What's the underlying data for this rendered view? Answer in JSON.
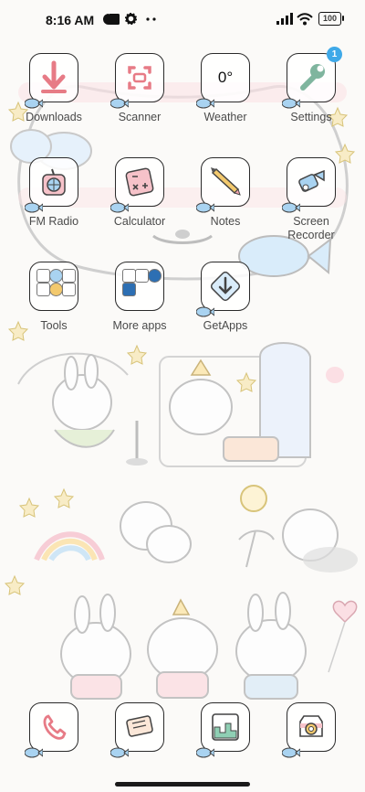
{
  "status_bar": {
    "time": "8:16 AM",
    "battery": "100",
    "icons": [
      "data-saver-icon",
      "square-notification-icon",
      "gear-icon",
      "more-dots-icon",
      "signal-icon",
      "wifi-icon",
      "battery-icon"
    ]
  },
  "apps_row1": [
    {
      "label": "Downloads",
      "icon": "download-arrow-icon"
    },
    {
      "label": "Scanner",
      "icon": "scanner-icon"
    },
    {
      "label": "Weather",
      "icon": "weather-icon",
      "temp": "0°"
    },
    {
      "label": "Settings",
      "icon": "wrench-icon",
      "badge": "1"
    }
  ],
  "apps_row2": [
    {
      "label": "FM Radio",
      "icon": "radio-icon"
    },
    {
      "label": "Calculator",
      "icon": "calculator-icon"
    },
    {
      "label": "Notes",
      "icon": "pencil-icon"
    },
    {
      "label": "Screen Recorder",
      "icon": "camera-recorder-icon"
    }
  ],
  "apps_row3": [
    {
      "label": "Tools",
      "icon": "folder-icon"
    },
    {
      "label": "More apps",
      "icon": "folder-icon"
    },
    {
      "label": "GetApps",
      "icon": "store-download-icon"
    }
  ],
  "dock": [
    {
      "name": "Phone",
      "icon": "phone-icon"
    },
    {
      "name": "Messages",
      "icon": "message-icon"
    },
    {
      "name": "Gallery",
      "icon": "gallery-icon"
    },
    {
      "name": "Camera",
      "icon": "camera-icon"
    }
  ],
  "colors": {
    "badge": "#3fa9e8",
    "accent_pink": "#f6b9c2",
    "accent_blue": "#a9d3f1"
  }
}
